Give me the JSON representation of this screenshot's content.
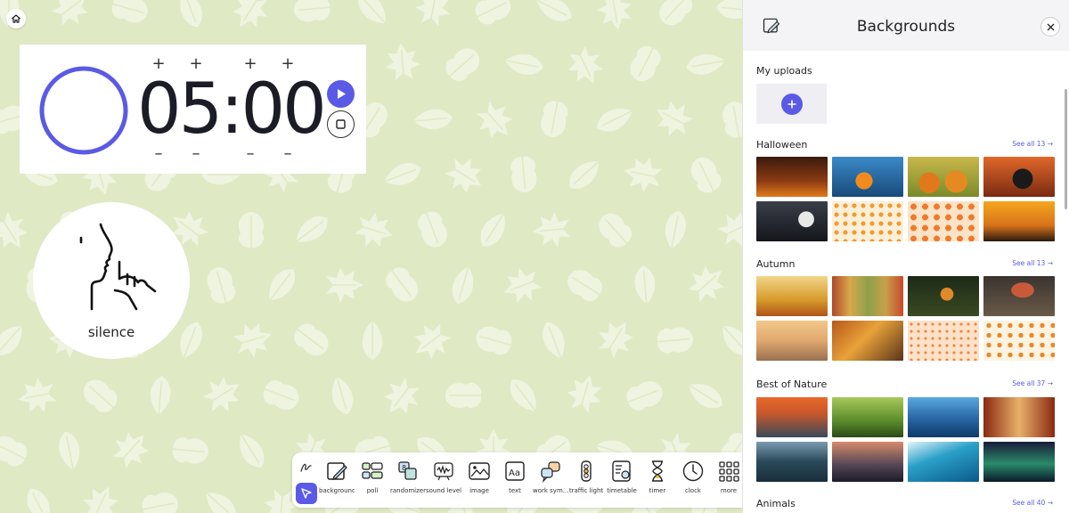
{
  "timer": {
    "minutes": "05",
    "separator": ":",
    "seconds": "00",
    "plus": "+",
    "minus": "–",
    "accent": "#5a5ae6"
  },
  "silence_widget": {
    "label": "silence",
    "icon": "silence-icon"
  },
  "toolbar": {
    "items": [
      {
        "label": "background",
        "icon": "background-icon"
      },
      {
        "label": "poll",
        "icon": "poll-icon"
      },
      {
        "label": "randomizer",
        "icon": "randomizer-icon"
      },
      {
        "label": "sound level",
        "icon": "sound-level-icon"
      },
      {
        "label": "image",
        "icon": "image-icon"
      },
      {
        "label": "text",
        "icon": "text-icon"
      },
      {
        "label": "work sym...",
        "icon": "work-symbols-icon"
      },
      {
        "label": "traffic light",
        "icon": "traffic-light-icon"
      },
      {
        "label": "timetable",
        "icon": "timetable-icon"
      },
      {
        "label": "timer",
        "icon": "hourglass-icon"
      },
      {
        "label": "clock",
        "icon": "clock-icon"
      },
      {
        "label": "more",
        "icon": "grid-icon"
      }
    ]
  },
  "panel": {
    "title": "Backgrounds",
    "uploads_title": "My uploads",
    "sections": [
      {
        "title": "Halloween",
        "see_all": "See all 13"
      },
      {
        "title": "Autumn",
        "see_all": "See all 13"
      },
      {
        "title": "Best of Nature",
        "see_all": "See all 37"
      },
      {
        "title": "Animals",
        "see_all": "See all 40"
      }
    ]
  },
  "colors": {
    "board": "#dfe9c4",
    "leaf": "#eef4df",
    "accent": "#5a5ae6"
  }
}
